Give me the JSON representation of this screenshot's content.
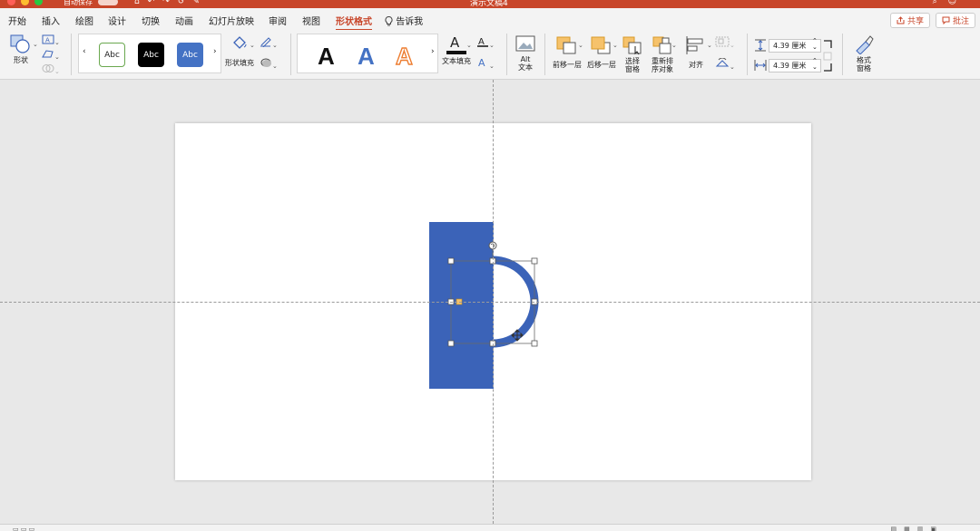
{
  "window": {
    "title": "演示文稿4",
    "autosave_label": "自动保存",
    "colors": {
      "titlebar": "#c8462a",
      "close": "#ff5f57",
      "minimize": "#febc2e",
      "zoom": "#28c840"
    }
  },
  "tabs": [
    {
      "label": "开始"
    },
    {
      "label": "插入"
    },
    {
      "label": "绘图"
    },
    {
      "label": "设计"
    },
    {
      "label": "切换"
    },
    {
      "label": "动画"
    },
    {
      "label": "幻灯片放映"
    },
    {
      "label": "审阅"
    },
    {
      "label": "视图"
    },
    {
      "label": "形状格式",
      "active": true
    }
  ],
  "tell_me": "告诉我",
  "share_label": "共享",
  "comments_label": "批注",
  "ribbon": {
    "shape_label": "形状",
    "shape_fill_label": "形状填充",
    "style_samples": [
      "Abc",
      "Abc",
      "Abc"
    ],
    "wordart_sample": "A",
    "text_fill_label": "文本填充",
    "alt_text_label": "Alt\n文本",
    "alt_text_line1": "Alt",
    "alt_text_line2": "文本",
    "bring_forward_label": "前移一层",
    "send_backward_label": "后移一层",
    "selection_pane_line1": "选择",
    "selection_pane_line2": "窗格",
    "reorder_line1": "重新排",
    "reorder_line2": "序对象",
    "align_label": "对齐",
    "height_value": "4.39 厘米",
    "width_value": "4.39 厘米",
    "format_pane_line1": "格式",
    "format_pane_line2": "窗格"
  },
  "colors": {
    "accent": "#c8462a",
    "shape_blue": "#3b63b8",
    "wordart_blue": "#4472c4",
    "wordart_orange": "#ed7d31"
  },
  "icons": [
    "shapes-icon",
    "textbox-icon",
    "edit-shape-icon",
    "merge-shapes-icon",
    "paint-bucket-icon",
    "pen-outline-icon",
    "effects-icon",
    "text-fill-icon",
    "text-outline-icon",
    "text-effects-icon",
    "alt-text-icon",
    "bring-forward-icon",
    "send-backward-icon",
    "selection-pane-icon",
    "reorder-icon",
    "align-icon",
    "group-icon",
    "rotate-icon",
    "height-icon",
    "width-icon",
    "crop-corner-icon",
    "format-pane-icon",
    "search-icon",
    "user-icon",
    "share-icon",
    "comment-icon",
    "lightbulb-icon",
    "rotate-handle-icon",
    "move-cursor-icon"
  ]
}
